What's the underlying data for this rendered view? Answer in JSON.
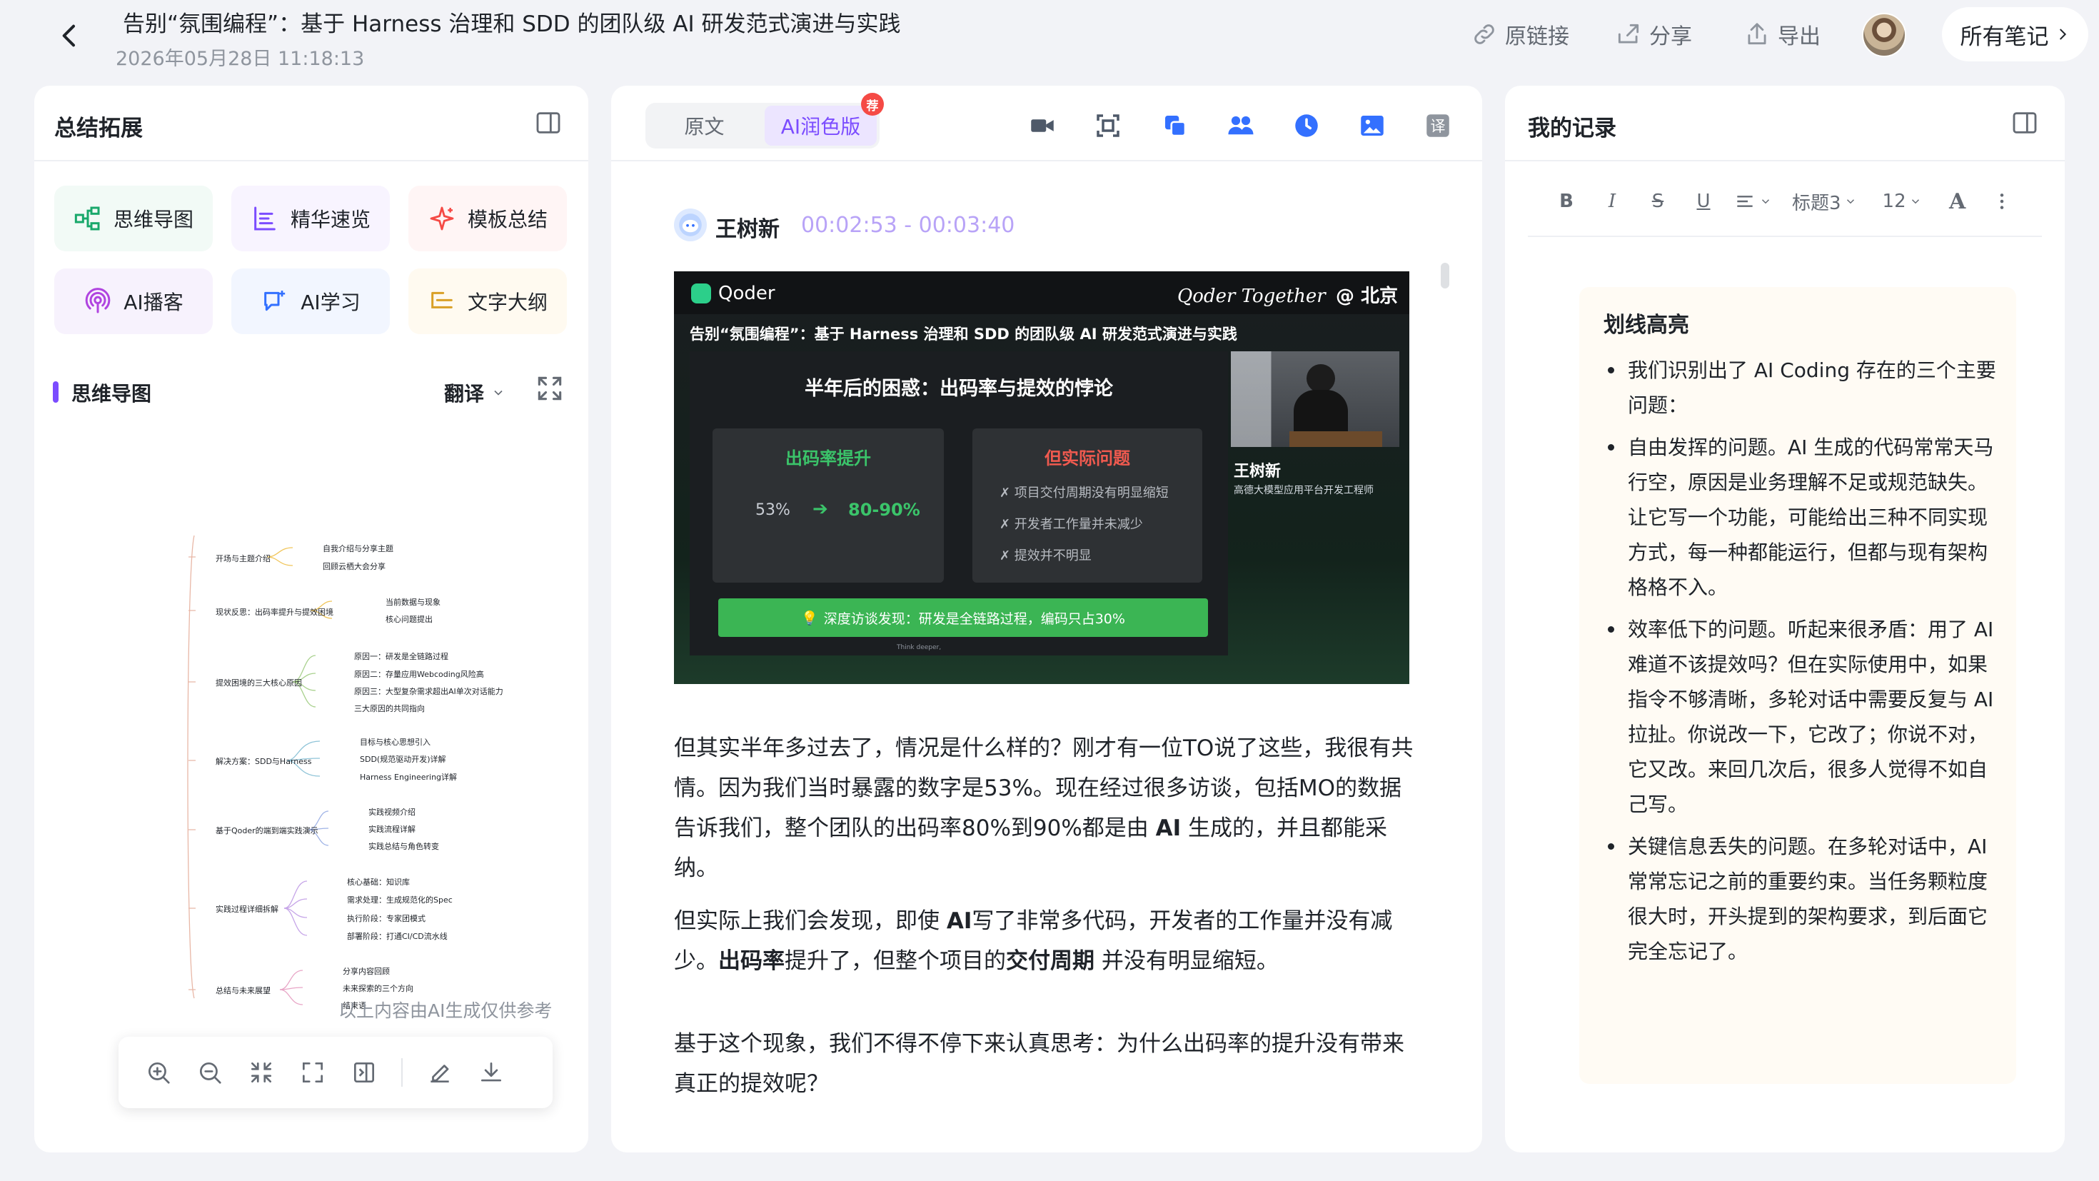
{
  "header": {
    "title": "告别“氛围编程”：基于 Harness 治理和 SDD 的团队级 AI 研发范式演进与实践",
    "datetime": "2026年05月28日 11:18:13",
    "actions": {
      "source_link": "原链接",
      "share": "分享",
      "export": "导出"
    },
    "all_notes": "所有笔记"
  },
  "left_panel": {
    "title": "总结拓展",
    "tools": [
      {
        "label": "思维导图",
        "icon": "mindmap-icon",
        "color": "#19a86b"
      },
      {
        "label": "精华速览",
        "icon": "highlight-list-icon",
        "color": "#7b4cff"
      },
      {
        "label": "模板总结",
        "icon": "sparkle-icon",
        "color": "#f54a45"
      },
      {
        "label": "AI播客",
        "icon": "podcast-icon",
        "color": "#b044e0"
      },
      {
        "label": "AI学习",
        "icon": "chat-learn-icon",
        "color": "#3370ff"
      },
      {
        "label": "文字大纲",
        "icon": "outline-icon",
        "color": "#d9a026"
      }
    ],
    "mindmap": {
      "section_label": "思维导图",
      "translate_label": "翻译",
      "branches": [
        {
          "label": "开场与主题介绍",
          "children": [
            "自我介绍与分享主题",
            "回顾云栖大会分享"
          ]
        },
        {
          "label": "现状反思：出码率提升与提效困境",
          "children": [
            "当前数据与现象",
            "核心问题提出"
          ]
        },
        {
          "label": "提效困境的三大核心原因",
          "children": [
            "原因一：研发是全链路过程",
            "原因二：存量应用Webcoding风险高",
            "原因三：大型复杂需求超出AI单次对话能力",
            "三大原因的共同指向"
          ]
        },
        {
          "label": "解决方案：SDD与Harness",
          "children": [
            "目标与核心思想引入",
            "SDD(规范驱动开发)详解",
            "Harness Engineering详解"
          ]
        },
        {
          "label": "基于Qoder的端到端实践演示",
          "children": [
            "实践视频介绍",
            "实践流程详解",
            "实践总结与角色转变"
          ]
        },
        {
          "label": "实践过程详细拆解",
          "children": [
            "核心基础：知识库",
            "需求处理：生成规范化的Spec",
            "执行阶段：专家团模式",
            "部署阶段：打通CI/CD流水线"
          ]
        },
        {
          "label": "总结与未来展望",
          "children": [
            "分享内容回顾",
            "未来探索的三个方向",
            "结束语"
          ]
        }
      ],
      "ai_note": "以上内容由AI生成仅供参考"
    },
    "toolbar": [
      "zoom-in-icon",
      "zoom-out-icon",
      "collapse-icon",
      "fullscreen-icon",
      "fit-width-icon",
      "edit-icon",
      "download-icon"
    ]
  },
  "middle_panel": {
    "tabs": [
      {
        "label": "原文",
        "active": false
      },
      {
        "label": "AI润色版",
        "active": true
      }
    ],
    "badge": "荐",
    "icons": [
      "video-icon",
      "screenshot-icon",
      "copy-icon",
      "people-icon",
      "clock-icon",
      "image-icon",
      "translate-icon"
    ],
    "speaker": {
      "name": "王树新",
      "time_range": "00:02:53 - 00:03:40"
    },
    "slide": {
      "brand": "Qoder",
      "tagline": "Qoder Together",
      "city": "@ 北京",
      "subtitle": "告别“氛围编程”：基于 Harness 治理和 SDD 的团队级 AI 研发范式演进与实践",
      "heading": "半年后的困惑：出码率与提效的悖论",
      "left_box_title": "出码率提升",
      "from_value": "53%",
      "to_value": "80-90%",
      "right_box_title": "但实际问题",
      "right_items": [
        "✗ 项目交付周期没有明显缩短",
        "✗ 开发者工作量并未减少",
        "✗ 提效并不明显"
      ],
      "banner": "深度访谈发现：研发是全链路过程，编码只占30%",
      "footer": "Think deeper,",
      "speaker_name": "王树新",
      "speaker_role": "高德大模型应用平台开发工程师"
    },
    "paragraphs": [
      {
        "segments": [
          {
            "text": "但其实半年多过去了，情况是什么样的？刚才有一位TO说了这些，我很有共情。因为我们当时暴露的数字是53%。现在经过很多访谈，包括MO的数据告诉我们，整个团队的出码率80%到90%都是由 ",
            "bold": false
          },
          {
            "text": "AI",
            "bold": true
          },
          {
            "text": " 生成的，并且都能采纳。",
            "bold": false
          }
        ]
      },
      {
        "segments": [
          {
            "text": "但实际上我们会发现，即使 ",
            "bold": false
          },
          {
            "text": "AI",
            "bold": true
          },
          {
            "text": "写了非常多代码，开发者的工作量并没有减少。",
            "bold": false
          },
          {
            "text": "出码率",
            "bold": true
          },
          {
            "text": "提升了，但整个项目的",
            "bold": false
          },
          {
            "text": "交付周期",
            "bold": true
          },
          {
            "text": " 并没有明显缩短。",
            "bold": false
          }
        ]
      },
      {
        "segments": [
          {
            "text": "基于这个现象，我们不得不停下来认真思考：为什么出码率的提升没有带来真正的提效呢？",
            "bold": false
          }
        ]
      }
    ]
  },
  "right_panel": {
    "title": "我的记录",
    "toolbar": {
      "bold": "B",
      "italic": "I",
      "strike": "S",
      "underline": "U",
      "heading": "标题3",
      "font_size": "12",
      "text_color": "A"
    },
    "highlight": {
      "title": "划线高亮",
      "items": [
        "我们识别出了 AI Coding 存在的三个主要问题：",
        "自由发挥的问题。AI 生成的代码常常天马行空，原因是业务理解不足或规范缺失。让它写一个功能，可能给出三种不同实现方式，每一种都能运行，但都与现有架构格格不入。",
        "效率低下的问题。听起来很矛盾：用了 AI 难道不该提效吗？但在实际使用中，如果指令不够清晰，多轮对话中需要反复与 AI 拉扯。你说改一下，它改了；你说不对，它又改。来回几次后，很多人觉得不如自己写。",
        "关键信息丢失的问题。在多轮对话中，AI 常常忘记之前的重要约束。当任务颗粒度很大时，开头提到的架构要求，到后面它完全忘记了。"
      ]
    }
  }
}
